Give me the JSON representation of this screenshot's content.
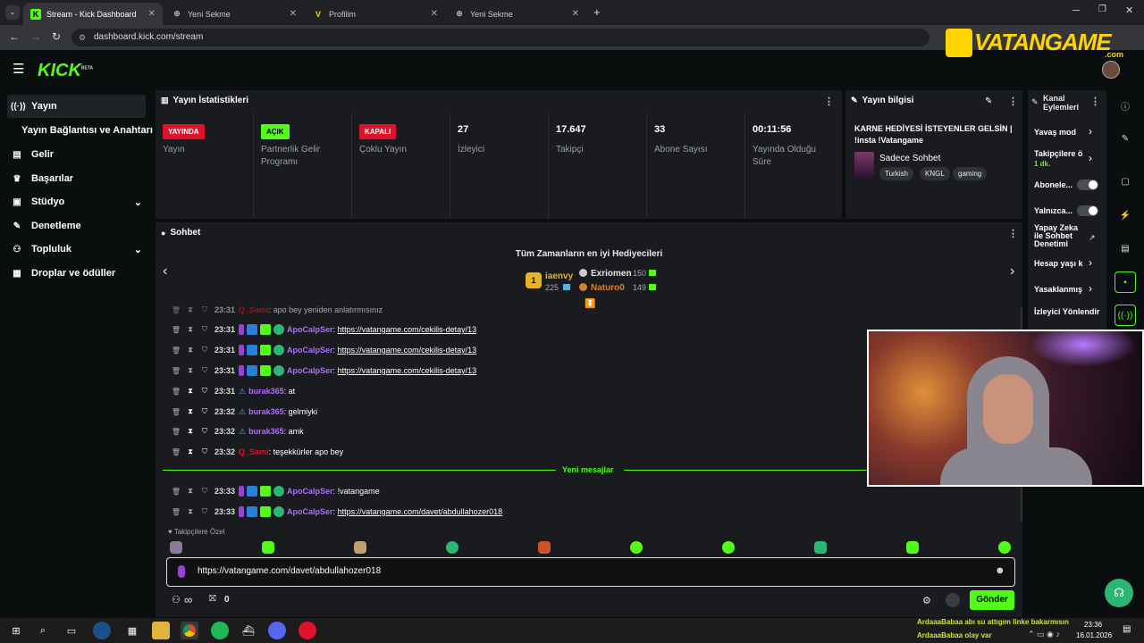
{
  "browser": {
    "tabs": [
      {
        "title": "Stream - Kick Dashboard",
        "favicon": "K",
        "color": "#53fc18",
        "active": true
      },
      {
        "title": "Yeni Sekme",
        "favicon": "⊕",
        "color": "#aaa",
        "active": false
      },
      {
        "title": "Profilim",
        "favicon": "V",
        "color": "#ffd400",
        "active": false
      },
      {
        "title": "Yeni Sekme",
        "favicon": "⊕",
        "color": "#aaa",
        "active": false
      }
    ],
    "new_tab": "+",
    "url": "dashboard.kick.com/stream"
  },
  "watermark": {
    "text": "VATANGAME",
    "sub": ".com"
  },
  "header": {
    "logo": "KICK",
    "logo_sup": "BETA"
  },
  "sidebar": {
    "items": [
      {
        "label": "Yayın",
        "icon": "((·))"
      },
      {
        "label": "Yayın Bağlantısı ve Anahtarı",
        "icon": ""
      },
      {
        "label": "Gelir",
        "icon": "▤"
      },
      {
        "label": "Başarılar",
        "icon": "🏆"
      },
      {
        "label": "Stüdyo",
        "icon": "▣"
      },
      {
        "label": "Denetleme",
        "icon": "🔧"
      },
      {
        "label": "Topluluk",
        "icon": "👥"
      },
      {
        "label": "Droplar ve ödüller",
        "icon": "▦"
      }
    ]
  },
  "stats": {
    "title": "Yayın İstatistikleri",
    "items": [
      {
        "badge": "YAYINDA",
        "badge_color": "#e0112b",
        "label": "Yayın"
      },
      {
        "badge": "AÇIK",
        "badge_color": "#53fc18",
        "label": "Partnerlik Gelir Programı"
      },
      {
        "badge": "KAPALI",
        "badge_color": "#e0112b",
        "label": "Çoklu Yayın"
      },
      {
        "value": "27",
        "label": "İzleyici"
      },
      {
        "value": "17.647",
        "label": "Takipçi"
      },
      {
        "value": "33",
        "label": "Abone Sayısı"
      },
      {
        "value": "00:11:56",
        "label": "Yayında Olduğu Süre"
      }
    ]
  },
  "info": {
    "title": "Yayın bilgisi",
    "stream_title": "KARNE HEDİYESİ İSTEYENLER GELSİN | !insta !Vatangame",
    "category": "Sadece Sohbet",
    "tags": [
      "Turkish",
      "KNGL",
      "gaming"
    ]
  },
  "actions": {
    "title": "Kanal Eylemleri",
    "items": [
      {
        "label": "Yavaş mod",
        "kind": "chev"
      },
      {
        "label": "Takipçilere ö",
        "sub": "1 dk.",
        "kind": "chev"
      },
      {
        "label": "Abonele...",
        "kind": "toggle"
      },
      {
        "label": "Yalnızca...",
        "kind": "toggle"
      },
      {
        "label": "Yapay Zeka ile Sohbet Denetimi",
        "kind": "ext"
      },
      {
        "label": "Hesap yaşı k",
        "kind": "chev"
      },
      {
        "label": "Yasaklanmış",
        "kind": "chev"
      },
      {
        "label": "İzleyici Yönlendir",
        "kind": "none"
      }
    ]
  },
  "chat": {
    "title": "Sohbet",
    "gifters_title": "Tüm Zamanların en iyi Hediyecileri",
    "gifters": [
      {
        "rank": "1",
        "name": "iaenvy",
        "amount": "225"
      },
      {
        "name": "Exriomen",
        "amount": "150"
      },
      {
        "name": "Naturo0",
        "amount": "149"
      }
    ],
    "messages": [
      {
        "time": "23:31",
        "user": "Q_Sami",
        "user_color": "#e0112b",
        "text": "apo bey yeniden anlatırmısınız",
        "badges": 0,
        "link": false
      },
      {
        "time": "23:31",
        "user": "ApoCalpSer",
        "user_color": "#b26bff",
        "text": "https://vatangame.com/cekilis-detay/13",
        "badges": 4,
        "link": true
      },
      {
        "time": "23:31",
        "user": "ApoCalpSer",
        "user_color": "#b26bff",
        "text": "https://vatangame.com/cekilis-detay/13",
        "badges": 4,
        "link": true
      },
      {
        "time": "23:31",
        "user": "ApoCalpSer",
        "user_color": "#b26bff",
        "text": "https://vatangame.com/cekilis-detay/13",
        "badges": 4,
        "link": true
      },
      {
        "time": "23:31",
        "user": "burak365",
        "user_color": "#b26bff",
        "text": "at",
        "badges": 1,
        "link": false
      },
      {
        "time": "23:32",
        "user": "burak365",
        "user_color": "#b26bff",
        "text": "gelmiyki",
        "badges": 1,
        "link": false
      },
      {
        "time": "23:32",
        "user": "burak365",
        "user_color": "#b26bff",
        "text": "amk",
        "badges": 1,
        "link": false
      },
      {
        "time": "23:32",
        "user": "Q_Sami",
        "user_color": "#e0112b",
        "text": "teşekkürler apo bey",
        "badges": 0,
        "link": false
      }
    ],
    "new_messages": "Yeni mesajlar",
    "messages2": [
      {
        "time": "23:33",
        "user": "ApoCalpSer",
        "user_color": "#b26bff",
        "text": "!vatangame",
        "badges": 4,
        "link": false
      },
      {
        "time": "23:33",
        "user": "ApoCalpSer",
        "user_color": "#b26bff",
        "text": "https://vatangame.com/davet/abdullahozer018",
        "badges": 4,
        "link": true
      }
    ],
    "followers_label": "Takipçilere Özel",
    "input_value": "https://vatangame.com/davet/abdullahozer018",
    "infinity": "∞",
    "count": "0",
    "send": "Gönder"
  },
  "taskbar": {
    "ticker": [
      "ArdaaaBabaa abı su attıgım linke bakarmısın",
      "ArdaaaBabaa olay var"
    ],
    "time": "23:36",
    "date": "16.01.2026"
  },
  "colors": {
    "accent": "#53fc18",
    "panel": "#191b1f",
    "bg": "#0b0e0f"
  }
}
